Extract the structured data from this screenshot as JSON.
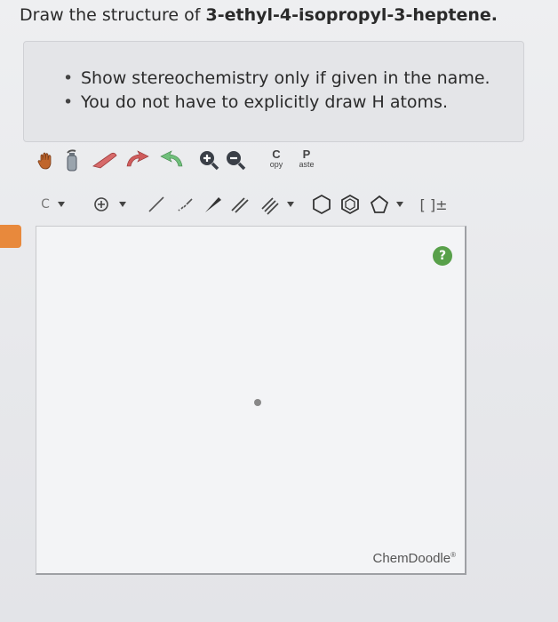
{
  "question": {
    "prefix": "Draw the structure of ",
    "compound": "3-ethyl-4-isopropyl-3-heptene."
  },
  "hints": [
    "Show stereochemistry only if given in the name.",
    "You do not have to explicitly draw H atoms."
  ],
  "toolbar": {
    "copy_big": "C",
    "copy_small": "opy",
    "paste_big": "P",
    "paste_small": "aste",
    "element_label": "C",
    "charge_bracket": "[ ]±"
  },
  "canvas": {
    "help_symbol": "?",
    "brand": "ChemDoodle",
    "brand_mark": "®"
  },
  "colors": {
    "accent_orange": "#e8893c",
    "help_green": "#58a04a",
    "icon_dark": "#3a3f47"
  }
}
